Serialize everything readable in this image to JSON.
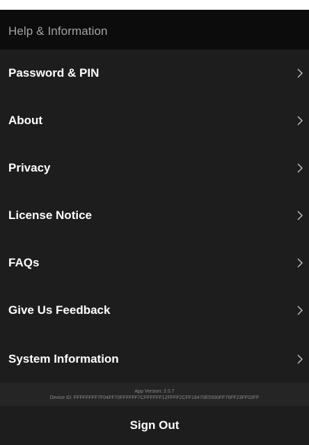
{
  "header": {
    "title": "Help & Information"
  },
  "menu": {
    "items": [
      {
        "label": "Password & PIN",
        "icon": "chevron-right-icon"
      },
      {
        "label": "About",
        "icon": "chevron-right-icon"
      },
      {
        "label": "Privacy",
        "icon": "chevron-right-icon"
      },
      {
        "label": "License Notice",
        "icon": "chevron-right-icon"
      },
      {
        "label": "FAQs",
        "icon": "chevron-right-icon"
      },
      {
        "label": "Give Us Feedback",
        "icon": "chevron-right-icon"
      },
      {
        "label": "System Information",
        "icon": "chevron-right-icon"
      }
    ]
  },
  "footer": {
    "app_version": "App Version: 2.0.7",
    "device_id": "Device ID: FFFFFFFF7F04FF70FFFFFF7CFFFFFF12FFFF2CFF18470E5930FF76FF23FF02FF"
  },
  "sign_out": {
    "label": "Sign Out"
  },
  "colors": {
    "background": "#1d1d1d",
    "header_background": "#0c0c0c",
    "header_text": "#a4a4a4",
    "item_text": "#ffffff",
    "footer_background": "#252525",
    "footer_text": "#8a8a8a"
  }
}
